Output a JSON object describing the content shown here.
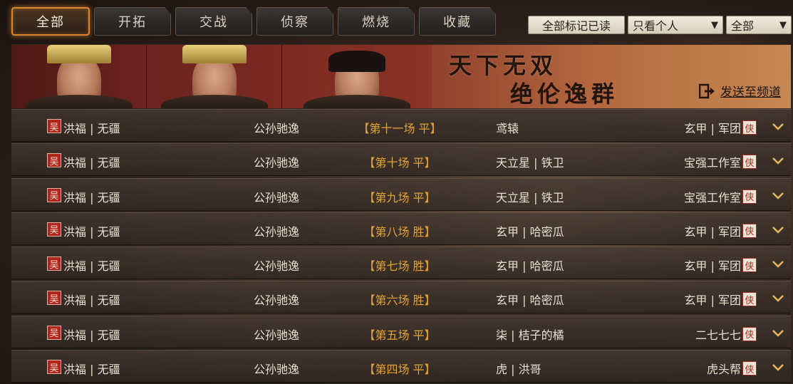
{
  "tabs": [
    {
      "label": "全部",
      "active": true
    },
    {
      "label": "开拓",
      "active": false
    },
    {
      "label": "交战",
      "active": false
    },
    {
      "label": "侦察",
      "active": false
    },
    {
      "label": "燃烧",
      "active": false
    },
    {
      "label": "收藏",
      "active": false
    }
  ],
  "controls": {
    "mark_all_read": "全部标记已读",
    "personal_filter": "只看个人",
    "scope_filter": "全部"
  },
  "banner": {
    "title": "天下无双",
    "subtitle": "绝伦逸群",
    "send_label": "发送至频道"
  },
  "colors": {
    "tab_active_border": "#d9862f",
    "match_text": "#e3a432",
    "badge_red": "#b0261e",
    "chevron": "#e9b85c"
  },
  "battles": [
    {
      "badge": "吴",
      "player1": "洪福 | 无疆",
      "player2": "公孙驰逸",
      "match": "【第十一场 平】",
      "player3": "鸢辕",
      "player4": "玄甲 | 军团",
      "hero_badge": "侠"
    },
    {
      "badge": "吴",
      "player1": "洪福 | 无疆",
      "player2": "公孙驰逸",
      "match": "【第十场 平】",
      "player3": "天立星 | 铁卫",
      "player4": "宝强工作室",
      "hero_badge": "侠"
    },
    {
      "badge": "吴",
      "player1": "洪福 | 无疆",
      "player2": "公孙驰逸",
      "match": "【第九场 平】",
      "player3": "天立星 | 铁卫",
      "player4": "宝强工作室",
      "hero_badge": "侠"
    },
    {
      "badge": "吴",
      "player1": "洪福 | 无疆",
      "player2": "公孙驰逸",
      "match": "【第八场 胜】",
      "player3": "玄甲 | 哈密瓜",
      "player4": "玄甲 | 军团",
      "hero_badge": "侠"
    },
    {
      "badge": "吴",
      "player1": "洪福 | 无疆",
      "player2": "公孙驰逸",
      "match": "【第七场 胜】",
      "player3": "玄甲 | 哈密瓜",
      "player4": "玄甲 | 军团",
      "hero_badge": "侠"
    },
    {
      "badge": "吴",
      "player1": "洪福 | 无疆",
      "player2": "公孙驰逸",
      "match": "【第六场 胜】",
      "player3": "玄甲 | 哈密瓜",
      "player4": "玄甲 | 军团",
      "hero_badge": "侠"
    },
    {
      "badge": "吴",
      "player1": "洪福 | 无疆",
      "player2": "公孙驰逸",
      "match": "【第五场 平】",
      "player3": "柒 | 桔子的橘",
      "player4": "二七七七",
      "hero_badge": "侠"
    },
    {
      "badge": "吴",
      "player1": "洪福 | 无疆",
      "player2": "公孙驰逸",
      "match": "【第四场 平】",
      "player3": "虎 | 洪哥",
      "player4": "虎头帮",
      "hero_badge": "侠"
    }
  ]
}
